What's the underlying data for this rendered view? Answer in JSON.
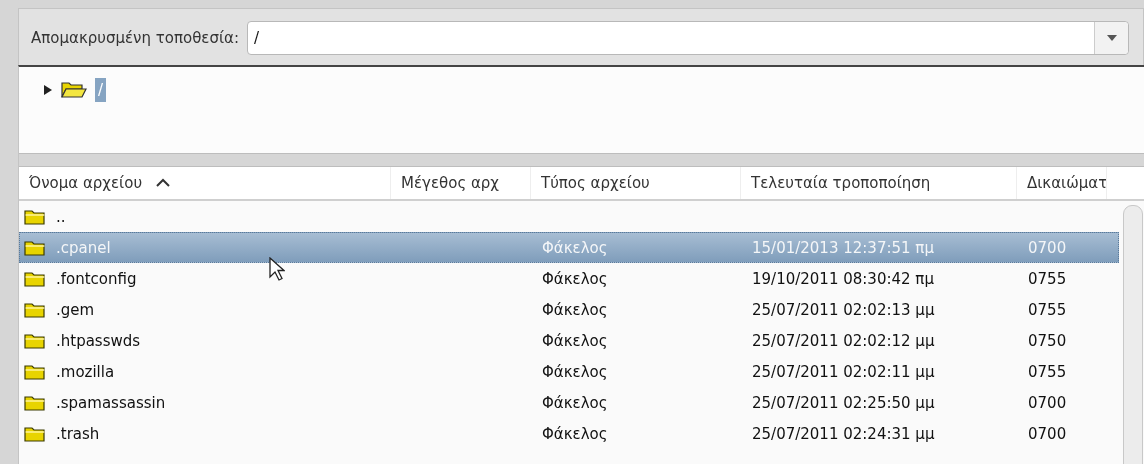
{
  "location": {
    "label": "Απομακρυσμένη τοποθεσία:",
    "value": "/"
  },
  "tree": [
    {
      "label": "/",
      "expanded": false,
      "selected": true
    }
  ],
  "table": {
    "columns": [
      {
        "label": "Όνομα αρχείου",
        "sorted": true
      },
      {
        "label": "Μέγεθος αρχ",
        "sorted": false
      },
      {
        "label": "Τύπος αρχείου",
        "sorted": false
      },
      {
        "label": "Τελευταία τροποποίηση",
        "sorted": false
      },
      {
        "label": "Δικαιώματ",
        "sorted": false
      }
    ],
    "rows": [
      {
        "name": "..",
        "selected": false
      },
      {
        "name": ".cpanel",
        "type": "Φάκελος",
        "modified": "15/01/2013 12:37:51 πμ",
        "permissions": "0700",
        "selected": true
      },
      {
        "name": ".fontconfig",
        "type": "Φάκελος",
        "modified": "19/10/2011 08:30:42 πμ",
        "permissions": "0755",
        "selected": false
      },
      {
        "name": ".gem",
        "type": "Φάκελος",
        "modified": "25/07/2011 02:02:13 μμ",
        "permissions": "0755",
        "selected": false
      },
      {
        "name": ".htpasswds",
        "type": "Φάκελος",
        "modified": "25/07/2011 02:02:12 μμ",
        "permissions": "0750",
        "selected": false
      },
      {
        "name": ".mozilla",
        "type": "Φάκελος",
        "modified": "25/07/2011 02:02:11 μμ",
        "permissions": "0755",
        "selected": false
      },
      {
        "name": ".spamassassin",
        "type": "Φάκελος",
        "modified": "25/07/2011 02:25:50 μμ",
        "permissions": "0700",
        "selected": false
      },
      {
        "name": ".trash",
        "type": "Φάκελος",
        "modified": "25/07/2011 02:24:31 μμ",
        "permissions": "0700",
        "selected": false
      }
    ]
  }
}
